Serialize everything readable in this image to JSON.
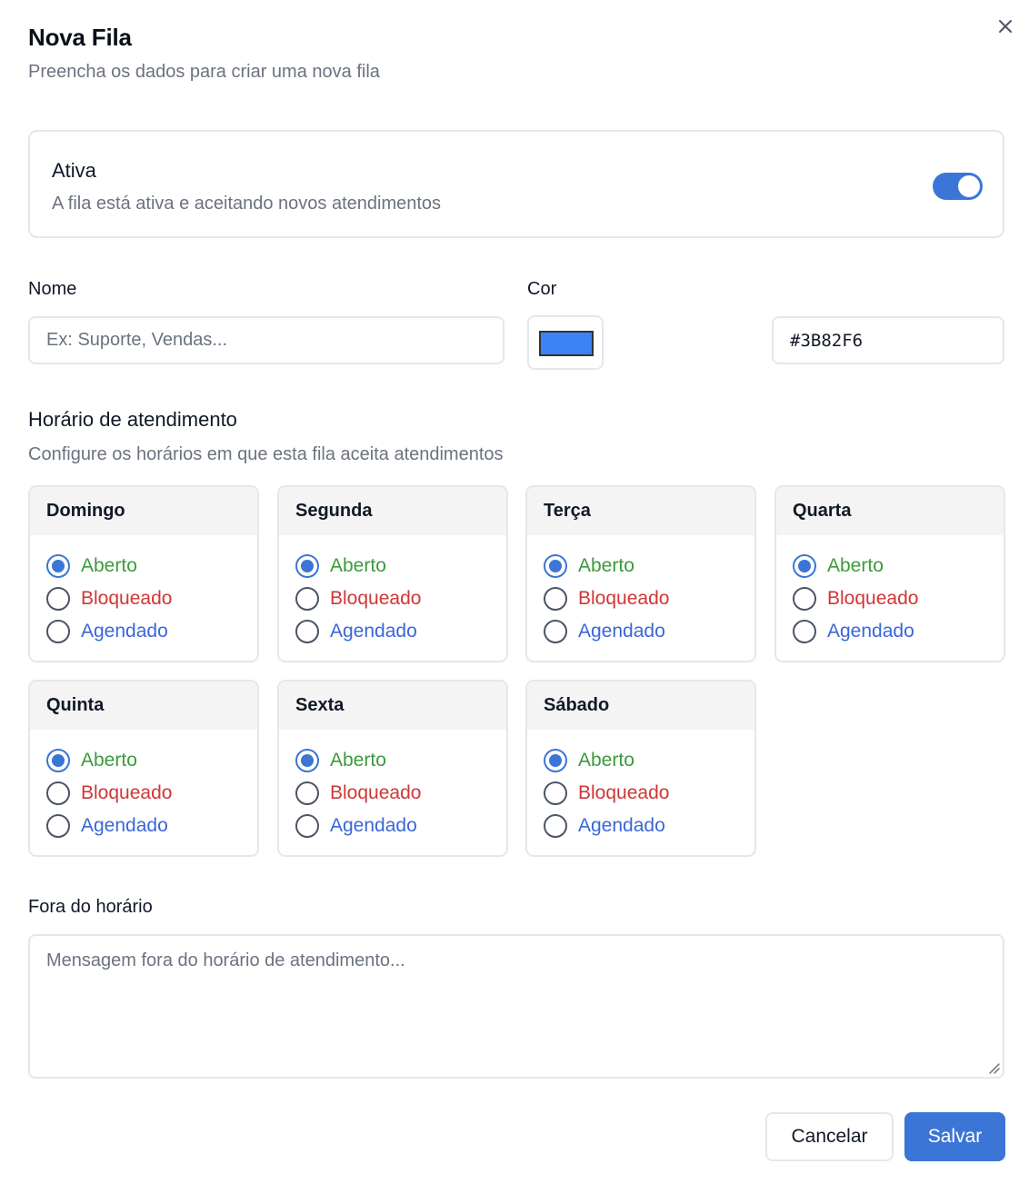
{
  "dialog": {
    "title": "Nova Fila",
    "subtitle": "Preencha os dados para criar uma nova fila",
    "close_icon": "close-icon"
  },
  "active": {
    "title": "Ativa",
    "description": "A fila está ativa e aceitando novos atendimentos",
    "enabled": true
  },
  "name": {
    "label": "Nome",
    "value": "",
    "placeholder": "Ex: Suporte, Vendas..."
  },
  "color": {
    "label": "Cor",
    "swatch": "#3B82F6",
    "hex_value": "#3B82F6"
  },
  "schedule": {
    "title": "Horário de atendimento",
    "description": "Configure os horários em que esta fila aceita atendimentos",
    "options": {
      "open": "Aberto",
      "blocked": "Bloqueado",
      "scheduled": "Agendado"
    },
    "option_colors": {
      "open": "#3c9a3c",
      "blocked": "#d23535",
      "scheduled": "#3a66d8"
    },
    "days": [
      {
        "name": "Domingo",
        "selected": "open"
      },
      {
        "name": "Segunda",
        "selected": "open"
      },
      {
        "name": "Terça",
        "selected": "open"
      },
      {
        "name": "Quarta",
        "selected": "open"
      },
      {
        "name": "Quinta",
        "selected": "open"
      },
      {
        "name": "Sexta",
        "selected": "open"
      },
      {
        "name": "Sábado",
        "selected": "open"
      }
    ]
  },
  "out_of_hours": {
    "label": "Fora do horário",
    "value": "",
    "placeholder": "Mensagem fora do horário de atendimento..."
  },
  "actions": {
    "cancel_label": "Cancelar",
    "save_label": "Salvar"
  },
  "colors": {
    "accent": "#3b76d6",
    "muted_text": "#6b7280",
    "border": "#e5e7eb"
  }
}
